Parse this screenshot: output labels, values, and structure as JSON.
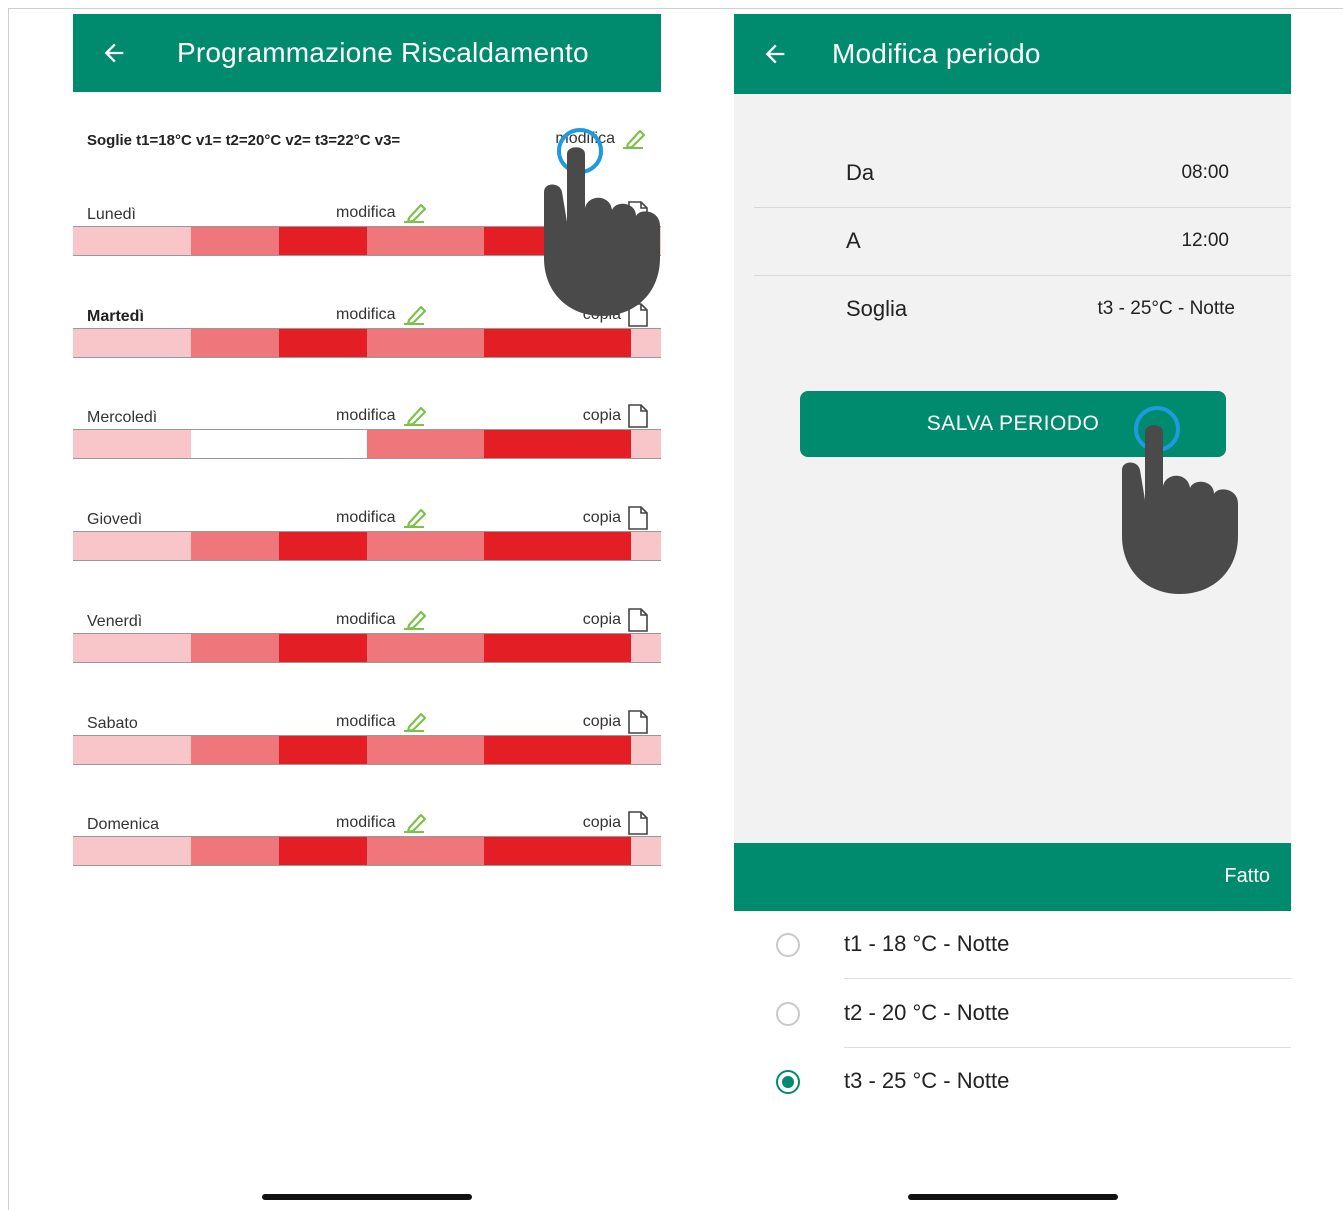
{
  "colors": {
    "brand": "#008a6e",
    "level_t1": "#f8c6c8",
    "level_t2": "#ef777c",
    "level_t3": "#e31e24",
    "level_off": "#ffffff",
    "tap_ring": "#1e9be0",
    "hand": "#4a4a4a"
  },
  "left_screen": {
    "title": "Programmazione Riscaldamento",
    "back_icon": "arrow-left-icon",
    "thresholds_text": "Soglie t1=18°C v1= t2=20°C v2= t3=22°C v3=",
    "thresholds_edit_label": "modifica",
    "edit_label": "modifica",
    "copy_label": "copia",
    "days": [
      {
        "name": "Lunedì",
        "bold": false,
        "levels": [
          "t1",
          "t1",
          "t1",
          "t1",
          "t2",
          "t2",
          "t2",
          "t3",
          "t3",
          "t3",
          "t2",
          "t2",
          "t2",
          "t2",
          "t3",
          "t3",
          "t3",
          "t3",
          "t3",
          "t1"
        ]
      },
      {
        "name": "Martedì",
        "bold": true,
        "levels": [
          "t1",
          "t1",
          "t1",
          "t1",
          "t2",
          "t2",
          "t2",
          "t3",
          "t3",
          "t3",
          "t2",
          "t2",
          "t2",
          "t2",
          "t3",
          "t3",
          "t3",
          "t3",
          "t3",
          "t1"
        ]
      },
      {
        "name": "Mercoledì",
        "bold": false,
        "levels": [
          "t1",
          "t1",
          "t1",
          "t1",
          "off",
          "off",
          "off",
          "off",
          "off",
          "off",
          "t2",
          "t2",
          "t2",
          "t2",
          "t3",
          "t3",
          "t3",
          "t3",
          "t3",
          "t1"
        ]
      },
      {
        "name": "Giovedì",
        "bold": false,
        "levels": [
          "t1",
          "t1",
          "t1",
          "t1",
          "t2",
          "t2",
          "t2",
          "t3",
          "t3",
          "t3",
          "t2",
          "t2",
          "t2",
          "t2",
          "t3",
          "t3",
          "t3",
          "t3",
          "t3",
          "t1"
        ]
      },
      {
        "name": "Venerdì",
        "bold": false,
        "levels": [
          "t1",
          "t1",
          "t1",
          "t1",
          "t2",
          "t2",
          "t2",
          "t3",
          "t3",
          "t3",
          "t2",
          "t2",
          "t2",
          "t2",
          "t3",
          "t3",
          "t3",
          "t3",
          "t3",
          "t1"
        ]
      },
      {
        "name": "Sabato",
        "bold": false,
        "levels": [
          "t1",
          "t1",
          "t1",
          "t1",
          "t2",
          "t2",
          "t2",
          "t3",
          "t3",
          "t3",
          "t2",
          "t2",
          "t2",
          "t2",
          "t3",
          "t3",
          "t3",
          "t3",
          "t3",
          "t1"
        ]
      },
      {
        "name": "Domenica",
        "bold": false,
        "levels": [
          "t1",
          "t1",
          "t1",
          "t1",
          "t2",
          "t2",
          "t2",
          "t3",
          "t3",
          "t3",
          "t2",
          "t2",
          "t2",
          "t2",
          "t3",
          "t3",
          "t3",
          "t3",
          "t3",
          "t1"
        ]
      }
    ]
  },
  "right_screen": {
    "title": "Modifica periodo",
    "back_icon": "arrow-left-icon",
    "from_label": "Da",
    "from_value": "08:00",
    "to_label": "A",
    "to_value": "12:00",
    "threshold_label": "Soglia",
    "threshold_value": "t3 - 25°C - Notte",
    "save_label": "SALVA PERIODO",
    "done_label": "Fatto",
    "options": [
      {
        "label": "t1 - 18 °C - Notte",
        "selected": false
      },
      {
        "label": "t2 - 20 °C - Notte",
        "selected": false
      },
      {
        "label": "t3 - 25 °C - Notte",
        "selected": true
      }
    ]
  }
}
